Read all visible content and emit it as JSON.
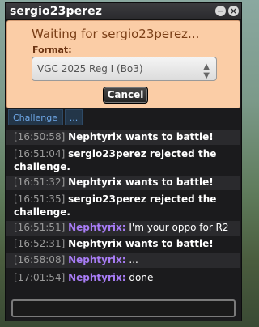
{
  "window": {
    "title": "sergio23perez"
  },
  "challenge": {
    "waiting_text": "Waiting for sergio23perez...",
    "format_label": "Format:",
    "format_value": "VGC 2025 Reg I (Bo3)",
    "cancel_label": "Cancel"
  },
  "tabs": {
    "challenge": "Challenge",
    "more": "..."
  },
  "messages": [
    {
      "time": "[16:50:58]",
      "user": "",
      "text": "Nephtyrix wants to battle!",
      "kind": "system"
    },
    {
      "time": "[16:51:04]",
      "user": "",
      "text": "sergio23perez rejected the challenge.",
      "kind": "system"
    },
    {
      "time": "[16:51:32]",
      "user": "",
      "text": "Nephtyrix wants to battle!",
      "kind": "system"
    },
    {
      "time": "[16:51:35]",
      "user": "",
      "text": "sergio23perez rejected the challenge.",
      "kind": "system"
    },
    {
      "time": "[16:51:51]",
      "user": "Nephtyrix:",
      "text": "I'm your oppo for R2",
      "kind": "chat"
    },
    {
      "time": "[16:52:31]",
      "user": "",
      "text": "Nephtyrix wants to battle!",
      "kind": "system"
    },
    {
      "time": "[16:58:08]",
      "user": "Nephtyrix:",
      "text": "...",
      "kind": "chat"
    },
    {
      "time": "[17:01:54]",
      "user": "Nephtyrix:",
      "text": "done",
      "kind": "chat"
    }
  ],
  "compose": {
    "value": ""
  }
}
